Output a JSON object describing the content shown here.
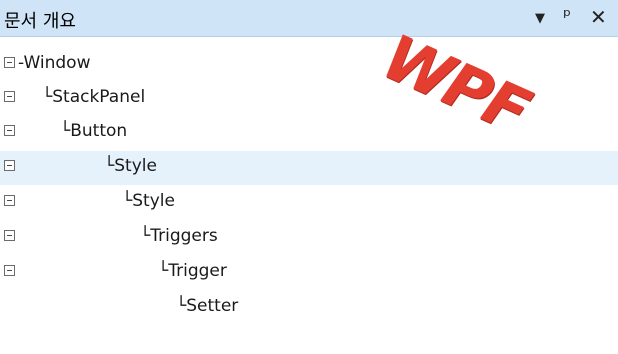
{
  "panel": {
    "title": "문서 개요",
    "icons": {
      "dropdown": "▼",
      "pin": "ᵖ",
      "close": "✕"
    }
  },
  "tree": {
    "nodes": [
      {
        "text": "-Window",
        "expander": true,
        "selected": false
      },
      {
        "text": "└StackPanel",
        "expander": true,
        "selected": false
      },
      {
        "text": "└Button",
        "expander": true,
        "selected": false
      },
      {
        "text": "└Style",
        "expander": true,
        "selected": true
      },
      {
        "text": "└Style",
        "expander": true,
        "selected": false
      },
      {
        "text": "└Triggers",
        "expander": true,
        "selected": false
      },
      {
        "text": "└Trigger",
        "expander": true,
        "selected": false
      },
      {
        "text": "└Setter",
        "expander": false,
        "selected": false
      }
    ]
  },
  "watermark": {
    "text": "WPF",
    "color": "#e43e30"
  },
  "colors": {
    "title_bg": "#cfe4f6",
    "selected_bg": "#e5f2fb"
  }
}
